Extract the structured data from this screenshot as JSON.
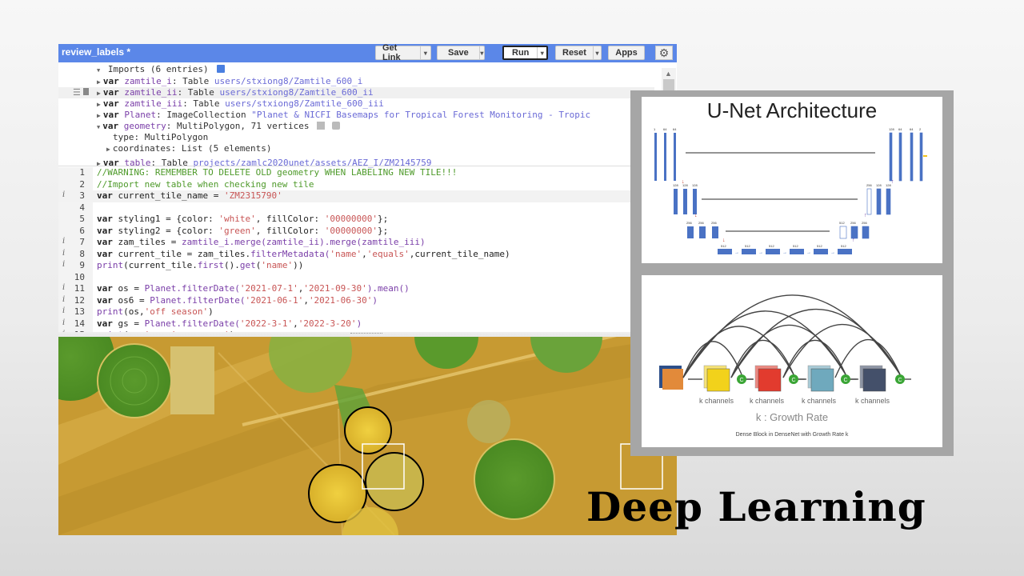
{
  "slide_title": "Deep Learning",
  "editor": {
    "script_name": "review_labels *",
    "toolbar": {
      "get_link": "Get Link",
      "save": "Save",
      "run": "Run",
      "reset": "Reset",
      "apps": "Apps",
      "dropdown_glyph": "▾",
      "settings_glyph": "⚙"
    },
    "imports_header": "Imports (6 entries)",
    "imports": [
      {
        "kw": "var",
        "name": "zamtile_i",
        "type": ": Table ",
        "path": "users/stxiong8/Zamtile_600_i"
      },
      {
        "kw": "var",
        "name": "zamtile_ii",
        "type": ": Table ",
        "path": "users/stxiong8/Zamtile_600_ii"
      },
      {
        "kw": "var",
        "name": "zamtile_iii",
        "type": ": Table ",
        "path": "users/stxiong8/Zamtile_600_iii"
      },
      {
        "kw": "var",
        "name": "Planet",
        "type": ": ImageCollection ",
        "path": "\"Planet & NICFI Basemaps for Tropical Forest Monitoring - Tropic"
      },
      {
        "kw": "var",
        "name": "geometry",
        "type": ": MultiPolygon, 71 vertices",
        "path": ""
      },
      {
        "kw": "var",
        "name": "table",
        "type": ": Table ",
        "path": "projects/zamlc2020unet/assets/AEZ_I/ZM2145759"
      }
    ],
    "geometry_details": {
      "type_line": "type: MultiPolygon",
      "coords_line": "coordinates: List (5 elements)"
    },
    "code_lines": [
      {
        "n": "1",
        "info": false,
        "parts": [
          {
            "c": "cm",
            "t": "//WARNING: REMEMBER TO DELETE OLD geometry WHEN LABELING NEW TILE!!!"
          }
        ]
      },
      {
        "n": "2",
        "info": false,
        "parts": [
          {
            "c": "cm",
            "t": "//Import new table when checking new tile"
          }
        ]
      },
      {
        "n": "3",
        "info": true,
        "active": true,
        "parts": [
          {
            "c": "kw",
            "t": "var"
          },
          {
            "c": "",
            "t": " current_tile_name = "
          },
          {
            "c": "str",
            "t": "'ZM2315790'"
          }
        ]
      },
      {
        "n": "4",
        "info": false,
        "parts": []
      },
      {
        "n": "5",
        "info": false,
        "parts": [
          {
            "c": "kw",
            "t": "var"
          },
          {
            "c": "",
            "t": " styling1 = {color: "
          },
          {
            "c": "str",
            "t": "'white'"
          },
          {
            "c": "",
            "t": ", fillColor: "
          },
          {
            "c": "str",
            "t": "'00000000'"
          },
          {
            "c": "",
            "t": "};"
          }
        ]
      },
      {
        "n": "6",
        "info": false,
        "parts": [
          {
            "c": "kw",
            "t": "var"
          },
          {
            "c": "",
            "t": " styling2 = {color: "
          },
          {
            "c": "str",
            "t": "'green'"
          },
          {
            "c": "",
            "t": ", fillColor: "
          },
          {
            "c": "str",
            "t": "'00000000'"
          },
          {
            "c": "",
            "t": "};"
          }
        ]
      },
      {
        "n": "7",
        "info": true,
        "parts": [
          {
            "c": "kw",
            "t": "var"
          },
          {
            "c": "",
            "t": " zam_tiles = "
          },
          {
            "c": "fn",
            "t": "zamtile_i.merge(zamtile_ii).merge(zamtile_iii)"
          }
        ]
      },
      {
        "n": "8",
        "info": true,
        "parts": [
          {
            "c": "kw",
            "t": "var"
          },
          {
            "c": "",
            "t": " current_tile = zam_tiles."
          },
          {
            "c": "fn",
            "t": "filterMetadata("
          },
          {
            "c": "str",
            "t": "'name'"
          },
          {
            "c": "",
            "t": ","
          },
          {
            "c": "str",
            "t": "'equals'"
          },
          {
            "c": "",
            "t": ",current_tile_name)"
          }
        ]
      },
      {
        "n": "9",
        "info": true,
        "parts": [
          {
            "c": "fn",
            "t": "print"
          },
          {
            "c": "",
            "t": "(current_tile."
          },
          {
            "c": "fn",
            "t": "first"
          },
          {
            "c": "",
            "t": "()."
          },
          {
            "c": "fn",
            "t": "get"
          },
          {
            "c": "",
            "t": "("
          },
          {
            "c": "str",
            "t": "'name'"
          },
          {
            "c": "",
            "t": "))"
          }
        ]
      },
      {
        "n": "10",
        "info": false,
        "parts": []
      },
      {
        "n": "11",
        "info": true,
        "parts": [
          {
            "c": "kw",
            "t": "var"
          },
          {
            "c": "",
            "t": " os = "
          },
          {
            "c": "fn",
            "t": "Planet.filterDate("
          },
          {
            "c": "str",
            "t": "'2021-07-1'"
          },
          {
            "c": "",
            "t": ","
          },
          {
            "c": "str",
            "t": "'2021-09-30'"
          },
          {
            "c": "fn",
            "t": ").mean()"
          }
        ]
      },
      {
        "n": "12",
        "info": true,
        "parts": [
          {
            "c": "kw",
            "t": "var"
          },
          {
            "c": "",
            "t": " os6 = "
          },
          {
            "c": "fn",
            "t": "Planet.filterDate("
          },
          {
            "c": "str",
            "t": "'2021-06-1'"
          },
          {
            "c": "",
            "t": ","
          },
          {
            "c": "str",
            "t": "'2021-06-30'"
          },
          {
            "c": "fn",
            "t": ")"
          }
        ]
      },
      {
        "n": "13",
        "info": true,
        "parts": [
          {
            "c": "fn",
            "t": "print"
          },
          {
            "c": "",
            "t": "(os,"
          },
          {
            "c": "str",
            "t": "'off season'"
          },
          {
            "c": "",
            "t": ")"
          }
        ]
      },
      {
        "n": "14",
        "info": true,
        "parts": [
          {
            "c": "kw",
            "t": "var"
          },
          {
            "c": "",
            "t": " gs = "
          },
          {
            "c": "fn",
            "t": "Planet.filterDate("
          },
          {
            "c": "str",
            "t": "'2022-3-1'"
          },
          {
            "c": "",
            "t": ","
          },
          {
            "c": "str",
            "t": "'2022-3-20'"
          },
          {
            "c": "fn",
            "t": ")"
          }
        ]
      },
      {
        "n": "15",
        "info": true,
        "parts": [
          {
            "c": "fn",
            "t": "print"
          },
          {
            "c": "",
            "t": "(gs,"
          },
          {
            "c": "str",
            "t": "'growing season'"
          },
          {
            "c": "",
            "t": ")"
          }
        ]
      }
    ],
    "accent_color": "#5b87e8"
  },
  "unet_figure": {
    "title": "U-Net Architecture",
    "levels": [
      {
        "in_channels": [
          "1",
          "64",
          "64"
        ],
        "out_channels": [
          "128",
          "64",
          "64",
          "2"
        ]
      },
      {
        "in_channels": [
          "128",
          "128",
          "128"
        ],
        "out_channels": [
          "256",
          "128",
          "128"
        ]
      },
      {
        "in_channels": [
          "256",
          "256",
          "256"
        ],
        "out_channels": [
          "512",
          "256",
          "256"
        ]
      },
      {
        "in_channels": [
          "512",
          "512",
          "512"
        ],
        "out_channels": [
          "512",
          "512",
          "512"
        ]
      }
    ]
  },
  "densenet_figure": {
    "channel_labels": [
      "k channels",
      "k channels",
      "k channels",
      "k channels"
    ],
    "growth_rate": "k : Growth Rate",
    "caption": "Dense Block in DenseNet with Growth Rate k",
    "concat_symbol": "C",
    "block_colors": [
      "#f2d21b",
      "#e23b2e",
      "#6fa9bd",
      "#44506a"
    ]
  }
}
